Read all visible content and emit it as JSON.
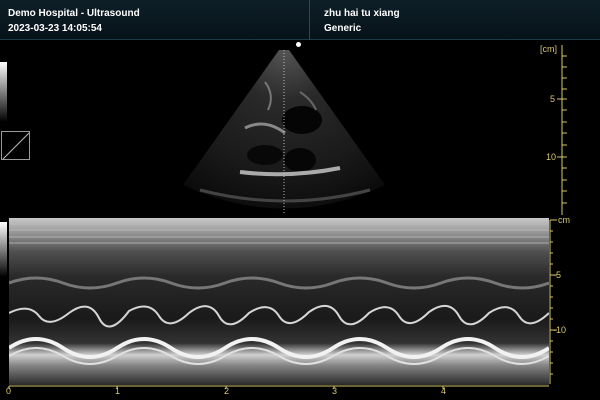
{
  "header": {
    "institution": "Demo Hospital - Ultrasound",
    "datetime": "2023-03-23 14:05:54",
    "patient_name": "zhu hai tu xiang",
    "preset": "Generic"
  },
  "b_mode": {
    "depth_unit": "[cm]",
    "depth_labels": [
      "5",
      "10"
    ]
  },
  "m_mode": {
    "depth_unit": "cm",
    "depth_labels": [
      "-5",
      "-10"
    ],
    "time_labels": [
      "0",
      "1",
      "2",
      "3",
      "4"
    ]
  },
  "colors": {
    "scale_accent": "#d9c66a",
    "header_bg": "#0e1f28",
    "image_bg": "#000000"
  },
  "icons": {
    "grayscale_map": "grayscale-bar",
    "gamma_curve": "gamma-curve-icon",
    "focus_marker": "focus-dot"
  }
}
